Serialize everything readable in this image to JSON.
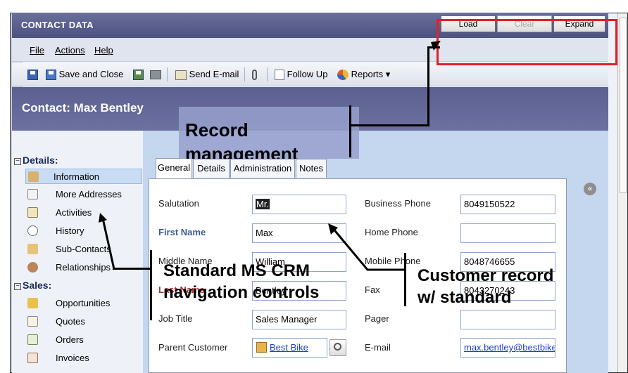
{
  "window": {
    "title": "CONTACT DATA"
  },
  "title_buttons": [
    {
      "label": "Load",
      "enabled": true
    },
    {
      "label": "Clear",
      "enabled": false
    },
    {
      "label": "Expand",
      "enabled": true
    }
  ],
  "menu": {
    "file": "File",
    "actions": "Actions",
    "help": "Help"
  },
  "toolbar": {
    "save_and_close": "Save and Close",
    "send_email": "Send E-mail",
    "follow_up": "Follow Up",
    "reports": "Reports ▾"
  },
  "contact": {
    "title": "Contact: Max Bentley"
  },
  "nav": {
    "details_header": "Details:",
    "details_items": [
      "Information",
      "More Addresses",
      "Activities",
      "History",
      "Sub-Contacts",
      "Relationships"
    ],
    "sales_header": "Sales:",
    "sales_items": [
      "Opportunities",
      "Quotes",
      "Orders",
      "Invoices"
    ]
  },
  "tabs": [
    "General",
    "Details",
    "Administration",
    "Notes"
  ],
  "form": {
    "salutation_label": "Salutation",
    "salutation_value": "Mr.",
    "first_name_label": "First Name",
    "first_name_value": "Max",
    "middle_name_label": "Middle Name",
    "middle_name_value": "William",
    "last_name_label": "Last Name",
    "last_name_value": "Bentley",
    "job_title_label": "Job Title",
    "job_title_value": "Sales Manager",
    "parent_customer_label": "Parent Customer",
    "parent_customer_value": "Best Bike",
    "business_phone_label": "Business Phone",
    "business_phone_value": "8049150522",
    "home_phone_label": "Home Phone",
    "home_phone_value": "",
    "mobile_phone_label": "Mobile Phone",
    "mobile_phone_value": "8048746655",
    "fax_label": "Fax",
    "fax_value": "8043270243",
    "pager_label": "Pager",
    "pager_value": "",
    "email_label": "E-mail",
    "email_value": "max.bentley@bestbike."
  },
  "annotations": {
    "record_management": "Record management",
    "nav_controls_line1": "Standard MS CRM",
    "nav_controls_line2": "navigation controls",
    "customer_record_line1": "Customer record",
    "customer_record_line2": "w/ standard"
  },
  "colors": {
    "title_bar": "#4c5181",
    "contact_bar": "#5b6090",
    "highlight_box": "#e0202a",
    "form_pane": "#c5d7ef"
  }
}
